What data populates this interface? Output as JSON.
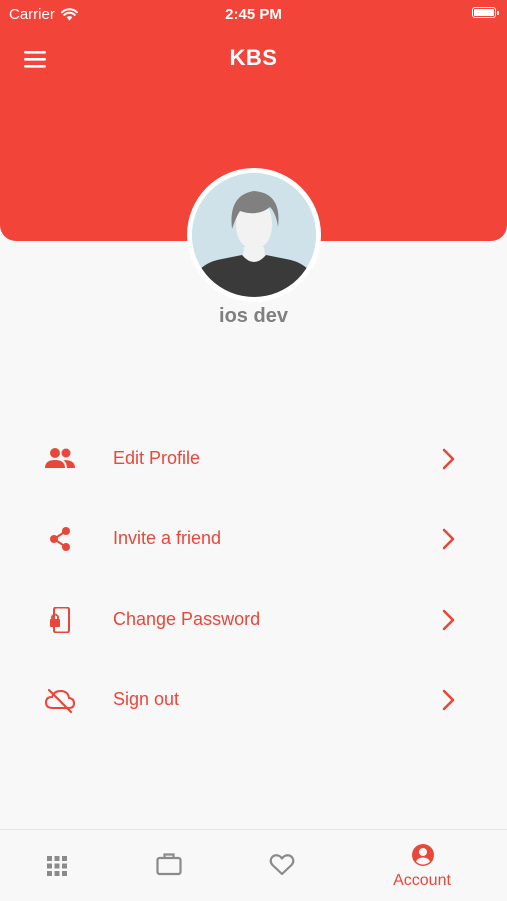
{
  "status": {
    "carrier": "Carrier",
    "time": "2:45 PM"
  },
  "header": {
    "title": "KBS"
  },
  "profile": {
    "name": "ios dev"
  },
  "menu": [
    {
      "label": "Edit Profile",
      "icon": "people-icon"
    },
    {
      "label": "Invite a friend",
      "icon": "share-icon"
    },
    {
      "label": "Change Password",
      "icon": "phone-lock-icon"
    },
    {
      "label": "Sign out",
      "icon": "cloud-off-icon"
    }
  ],
  "tabbar": {
    "tabs": [
      {
        "icon": "grid-icon",
        "label": ""
      },
      {
        "icon": "briefcase-icon",
        "label": ""
      },
      {
        "icon": "heart-icon",
        "label": ""
      },
      {
        "icon": "account-icon",
        "label": "Account",
        "active": true
      }
    ]
  },
  "colors": {
    "primary": "#f24438",
    "accent_text": "#e8473a",
    "inactive_icon": "#8a8a8a",
    "name_text": "#7f7f7f"
  }
}
